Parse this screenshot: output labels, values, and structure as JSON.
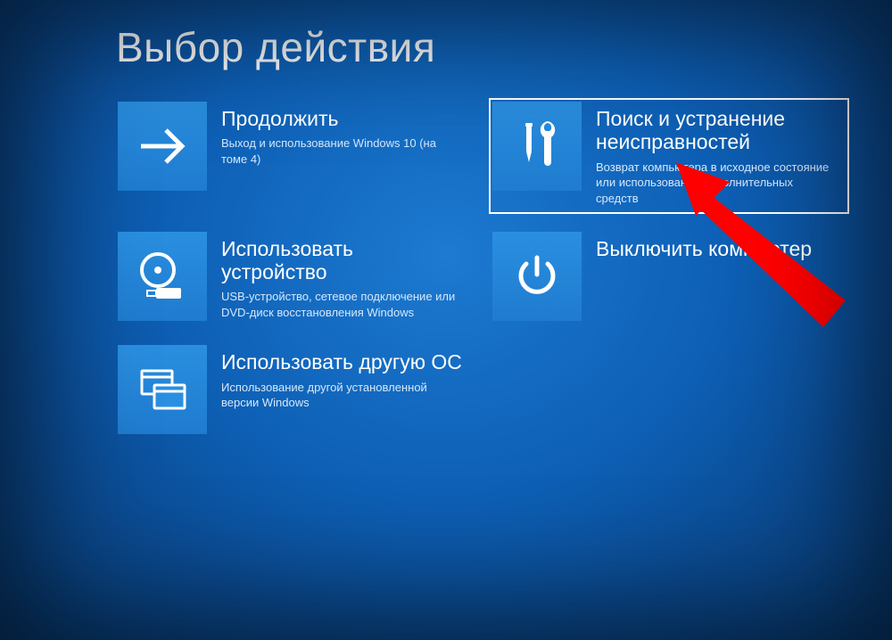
{
  "title": "Выбор действия",
  "tiles": {
    "continue": {
      "label": "Продолжить",
      "desc": "Выход и использование Windows 10 (на томе 4)"
    },
    "troubleshoot": {
      "label": "Поиск и устранение неисправностей",
      "desc": "Возврат компьютера в исходное состояние или использование дополнительных средств"
    },
    "use_device": {
      "label": "Использовать устройство",
      "desc": "USB-устройство, сетевое подключение или DVD-диск восстановления Windows"
    },
    "turn_off": {
      "label": "Выключить компьютер",
      "desc": ""
    },
    "use_other_os": {
      "label": "Использовать другую ОС",
      "desc": "Использование другой установленной версии Windows"
    }
  }
}
